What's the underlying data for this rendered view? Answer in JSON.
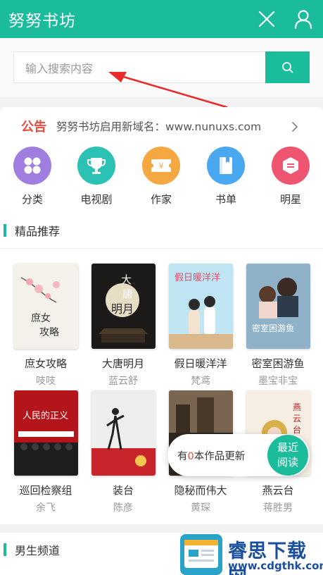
{
  "header": {
    "title": "努努书坊",
    "close_icon": "close-icon",
    "user_icon": "user-icon"
  },
  "search": {
    "placeholder": "输入搜索内容",
    "button_icon": "search-icon"
  },
  "notice": {
    "tag": "公告",
    "text": "努努书坊启用新域名：www.nunuxs.com"
  },
  "nav": [
    {
      "label": "分类",
      "icon": "grid-icon",
      "color": "#a07ee0"
    },
    {
      "label": "电视剧",
      "icon": "trophy-icon",
      "color": "#2cc1b5"
    },
    {
      "label": "作家",
      "icon": "ticket-icon",
      "color": "#f5a742"
    },
    {
      "label": "书单",
      "icon": "book-icon",
      "color": "#4aa8f0"
    },
    {
      "label": "明星",
      "icon": "star-card-icon",
      "color": "#ef5470"
    }
  ],
  "sections": {
    "featured": "精品推荐",
    "male": "男生频道"
  },
  "books": [
    {
      "name": "庶女攻略",
      "author": "吱吱",
      "cover_text": "庶女攻略"
    },
    {
      "name": "大唐明月",
      "author": "蓝云舒",
      "cover_text": "大唐明月"
    },
    {
      "name": "假日暖洋洋",
      "author": "梵鸢",
      "cover_text": "假日暖洋洋"
    },
    {
      "name": "密室困游鱼",
      "author": "墨宝非宝",
      "cover_text": "密室困游鱼"
    },
    {
      "name": "巡回检察组",
      "author": "余飞",
      "cover_text": "人民的正义"
    },
    {
      "name": "装台",
      "author": "陈彦",
      "cover_text": ""
    },
    {
      "name": "隐秘而伟大",
      "author": "黄琛",
      "cover_text": ""
    },
    {
      "name": "燕云台",
      "author": "蒋胜男",
      "cover_text": "燕云台"
    }
  ],
  "updates": {
    "prefix": "有",
    "count": "0",
    "suffix": "本作品更新",
    "recent_1": "最近",
    "recent_2": "阅读"
  },
  "watermark": {
    "brand": "睿思下载网",
    "site": "www.cdgthk.com"
  },
  "colors": {
    "primary": "#1abc9c",
    "notice": "#e74c3c",
    "watermark": "#1a4f9c"
  }
}
